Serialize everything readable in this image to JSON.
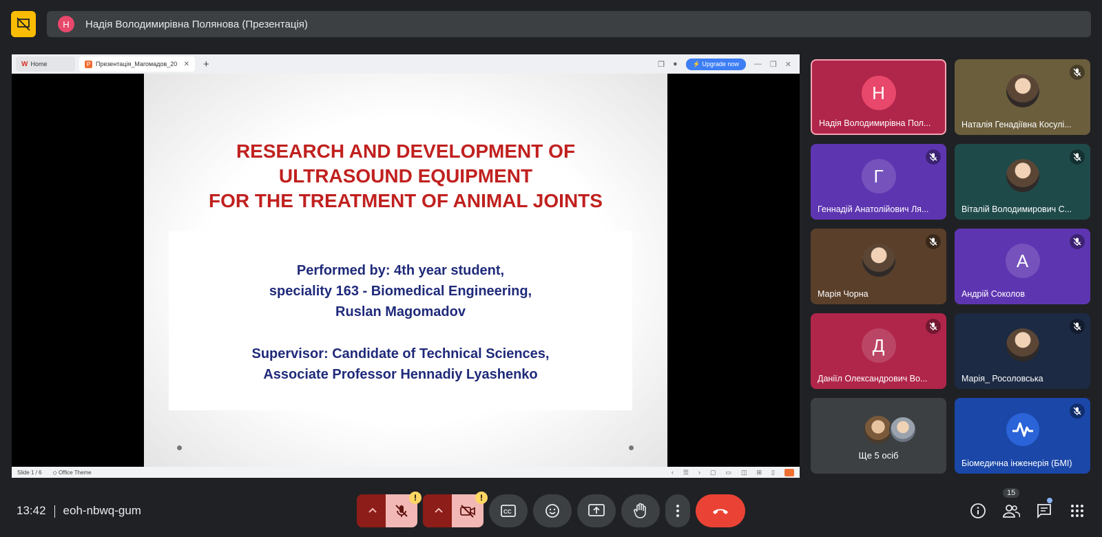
{
  "presenter_banner": {
    "avatar_letter": "Н",
    "text": "Надія Володимирівна Полянова (Презентація)"
  },
  "shared_screen": {
    "tabs": [
      {
        "label": "Home"
      },
      {
        "label": "Презентація_Магомадов_20"
      }
    ],
    "upgrade_label": "⚡ Upgrade now",
    "slide": {
      "title_lines": [
        "RESEARCH AND DEVELOPMENT OF",
        "ULTRASOUND EQUIPMENT",
        "FOR THE TREATMENT OF ANIMAL JOINTS"
      ],
      "author_lines": [
        "Performed by: 4th year student,",
        "speciality 163 - Biomedical Engineering,",
        "Ruslan Magomadov"
      ],
      "supervisor_lines": [
        "Supervisor: Candidate of Technical Sciences,",
        "Associate Professor Hennadiy Lyashenko"
      ]
    },
    "status": {
      "slide_counter": "Slide 1 / 6",
      "theme": "Office Theme"
    }
  },
  "participants": [
    {
      "name": "Надія Володимирівна Пол...",
      "letter": "Н",
      "muted": false,
      "active": true,
      "color": "#b0254a"
    },
    {
      "name": "Наталія Генадіївна Косулі...",
      "photo": true,
      "muted": true,
      "color": "#6b5e3c"
    },
    {
      "name": "Геннадій Анатолійович Ля...",
      "letter": "Г",
      "muted": true,
      "color": "#5e35b1"
    },
    {
      "name": "Віталій Володимирович С...",
      "photo": true,
      "muted": true,
      "color": "#1f4a4a"
    },
    {
      "name": "Марія Чорна",
      "photo": true,
      "muted": true,
      "color": "#5a3f2a"
    },
    {
      "name": "Андрій Соколов",
      "letter": "А",
      "muted": true,
      "color": "#5e35b1"
    },
    {
      "name": "Даніїл Олександрович Во...",
      "letter": "Д",
      "muted": true,
      "color": "#b0254a"
    },
    {
      "name": "Марія_ Росоловська",
      "photo": true,
      "muted": true,
      "color": "#1c2a44"
    },
    {
      "name": "Ще 5 осіб",
      "more": true,
      "color": "#3c4043"
    },
    {
      "name": "Біомедична інженерія (БМІ)",
      "logo": true,
      "muted": true,
      "color": "#1a47a8"
    }
  ],
  "bottom_bar": {
    "time": "13:42",
    "meeting_code": "eoh-nbwq-gum",
    "people_count": "15"
  }
}
